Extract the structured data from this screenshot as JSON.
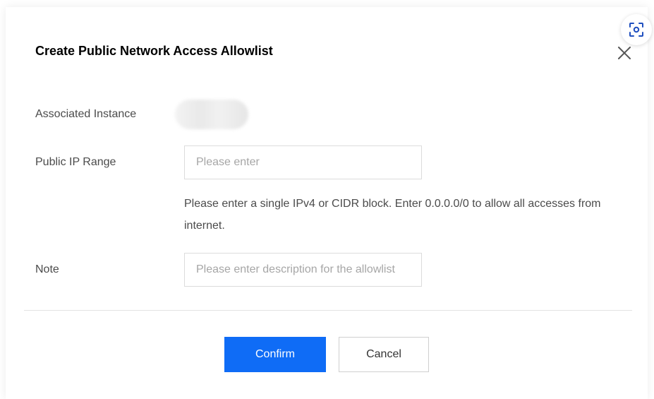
{
  "dialog": {
    "title": "Create Public Network Access Allowlist",
    "close_icon": "close-icon",
    "scan_icon": "scan-focus-icon"
  },
  "form": {
    "associated_instance": {
      "label": "Associated Instance"
    },
    "public_ip_range": {
      "label": "Public IP Range",
      "placeholder": "Please enter",
      "value": "",
      "help": "Please enter a single IPv4 or CIDR block. Enter 0.0.0.0/0 to allow all accesses from internet."
    },
    "note": {
      "label": "Note",
      "placeholder": "Please enter description for the allowlist",
      "value": ""
    }
  },
  "actions": {
    "confirm_label": "Confirm",
    "cancel_label": "Cancel"
  },
  "colors": {
    "primary": "#0f6cf6",
    "border": "#dcdcdc",
    "label_text": "#4b4b4b",
    "placeholder": "#a6a6a6"
  }
}
